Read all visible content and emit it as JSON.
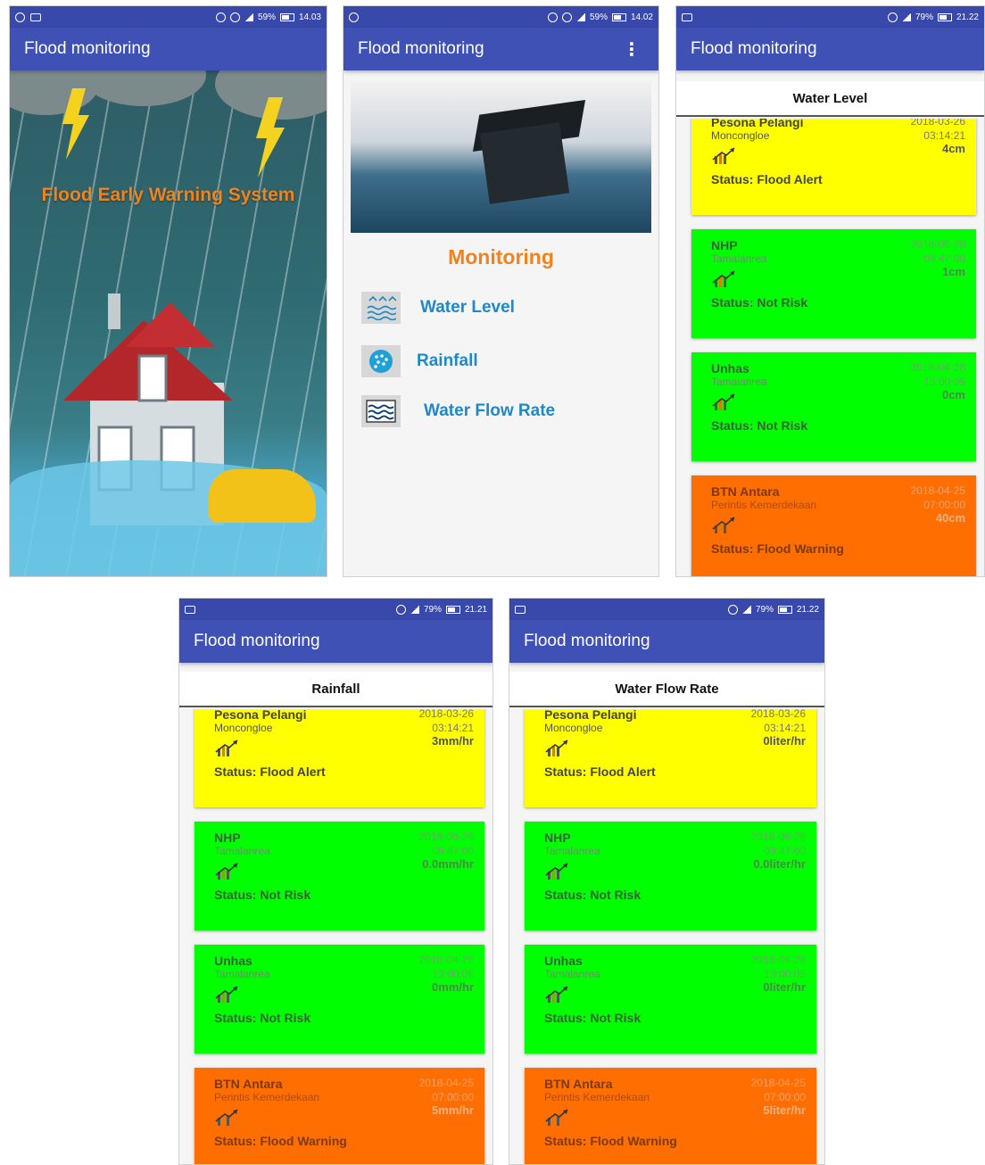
{
  "app": {
    "title": "Flood monitoring"
  },
  "statusbars": {
    "splash": {
      "battery": "59%",
      "time": "14.03"
    },
    "menu": {
      "battery": "59%",
      "time": "14.02"
    },
    "water_level": {
      "battery": "79%",
      "time": "21.22"
    },
    "rainfall": {
      "battery": "79%",
      "time": "21.21"
    },
    "water_flow": {
      "battery": "79%",
      "time": "21.22"
    }
  },
  "splash": {
    "title": "Flood Early Warning System"
  },
  "menu": {
    "heading": "Monitoring",
    "items": [
      {
        "label": "Water Level",
        "icon": "water-level-icon"
      },
      {
        "label": "Rainfall",
        "icon": "rainfall-icon"
      },
      {
        "label": "Water Flow Rate",
        "icon": "water-flow-icon"
      }
    ],
    "overflow_icon": "⋮"
  },
  "water_level": {
    "heading": "Water Level",
    "cards": [
      {
        "name": "Pesona Pelangi",
        "area": "Moncongloe",
        "date": "2018-03-26",
        "time": "03:14:21",
        "value": "4cm",
        "status": "Status: Flood Alert",
        "color": "yellow"
      },
      {
        "name": "NHP",
        "area": "Tamalanrea",
        "date": "2018-06-28",
        "time": "09:47:00",
        "value": "1cm",
        "status": "Status: Not Risk",
        "color": "green"
      },
      {
        "name": "Unhas",
        "area": "Tamalanrea",
        "date": "2018-04-26",
        "time": "13:00:05",
        "value": "0cm",
        "status": "Status: Not Risk",
        "color": "green"
      },
      {
        "name": "BTN Antara",
        "area": "Perintis Kemerdekaan",
        "date": "2018-04-25",
        "time": "07:00:00",
        "value": "40cm",
        "status": "Status: Flood Warning",
        "color": "orange"
      }
    ]
  },
  "rainfall": {
    "heading": "Rainfall",
    "cards": [
      {
        "name": "Pesona Pelangi",
        "area": "Moncongloe",
        "date": "2018-03-26",
        "time": "03:14:21",
        "value": "3mm/hr",
        "status": "Status: Flood Alert",
        "color": "yellow"
      },
      {
        "name": "NHP",
        "area": "Tamalanrea",
        "date": "2018-06-28",
        "time": "09:47:00",
        "value": "0.0mm/hr",
        "status": "Status: Not Risk",
        "color": "green"
      },
      {
        "name": "Unhas",
        "area": "Tamalanrea",
        "date": "2018-04-26",
        "time": "13:00:05",
        "value": "0mm/hr",
        "status": "Status: Not Risk",
        "color": "green"
      },
      {
        "name": "BTN Antara",
        "area": "Perintis Kemerdekaan",
        "date": "2018-04-25",
        "time": "07:00:00",
        "value": "5mm/hr",
        "status": "Status: Flood Warning",
        "color": "orange"
      }
    ]
  },
  "water_flow": {
    "heading": "Water Flow Rate",
    "cards": [
      {
        "name": "Pesona Pelangi",
        "area": "Moncongloe",
        "date": "2018-03-26",
        "time": "03:14:21",
        "value": "0liter/hr",
        "status": "Status: Flood Alert",
        "color": "yellow"
      },
      {
        "name": "NHP",
        "area": "Tamalanrea",
        "date": "2018-06-28",
        "time": "09:47:00",
        "value": "0.0liter/hr",
        "status": "Status: Not Risk",
        "color": "green"
      },
      {
        "name": "Unhas",
        "area": "Tamalanrea",
        "date": "2018-04-26",
        "time": "13:00:05",
        "value": "0liter/hr",
        "status": "Status: Not Risk",
        "color": "green"
      },
      {
        "name": "BTN Antara",
        "area": "Perintis Kemerdekaan",
        "date": "2018-04-25",
        "time": "07:00:00",
        "value": "5liter/hr",
        "status": "Status: Flood Warning",
        "color": "orange"
      }
    ]
  },
  "colors": {
    "appbar": "#3f51b5",
    "statusbar": "#3949ab",
    "accent_orange": "#f2821b",
    "link_blue": "#1e88c8",
    "alert_yellow": "#ffff00",
    "safe_green": "#00ff00",
    "warning_orange": "#ff6e00"
  }
}
